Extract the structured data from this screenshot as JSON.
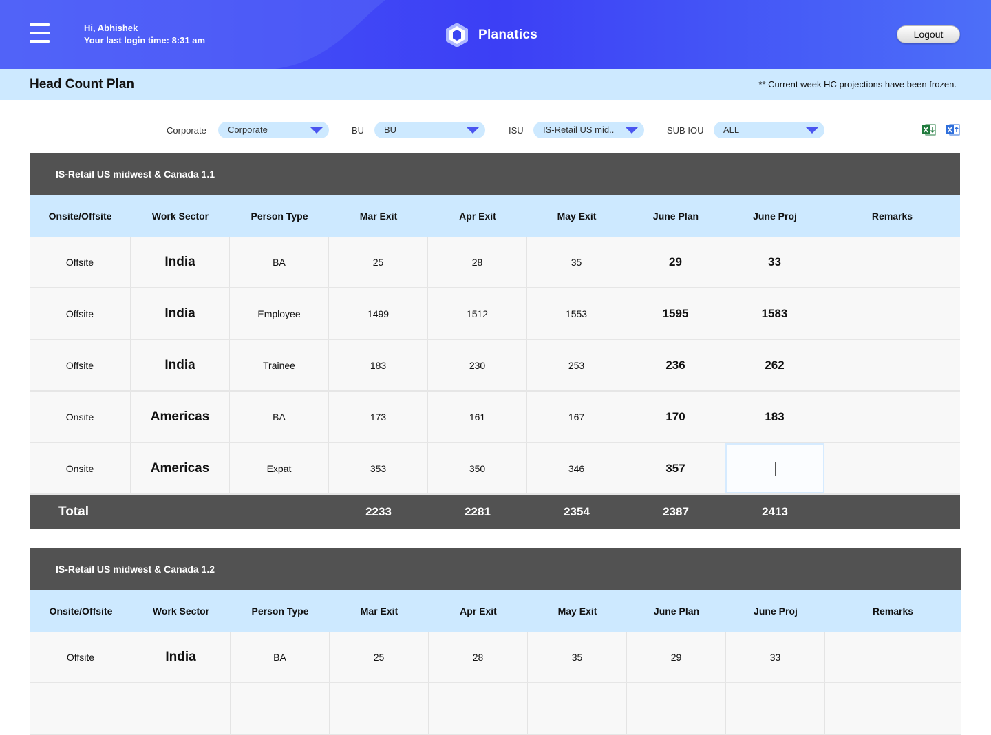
{
  "header": {
    "greeting": "Hi, Abhishek",
    "last_login": "Your last login time: 8:31 am",
    "brand_name": "Planatics",
    "logout_label": "Logout"
  },
  "titlebar": {
    "title": "Head Count Plan",
    "note": "** Current week HC projections have been frozen."
  },
  "filters": {
    "corporate": {
      "label": "Corporate",
      "value": "Corporate"
    },
    "bu": {
      "label": "BU",
      "value": "BU"
    },
    "isu": {
      "label": "ISU",
      "value": "IS-Retail US mid.."
    },
    "subiou": {
      "label": "SUB IOU",
      "value": "ALL"
    }
  },
  "export_icons": [
    "excel-download-icon",
    "excel-upload-icon"
  ],
  "colors": {
    "header": "#3b4cf5",
    "accent_light": "#cde9ff",
    "section_bar": "#525252",
    "excel_green": "#1f7a3c",
    "upload_blue": "#2f6fdb"
  },
  "columns": [
    "Onsite/Offsite",
    "Work Sector",
    "Person Type",
    "Mar Exit",
    "Apr Exit",
    "May Exit",
    "June Plan",
    "June Proj",
    "Remarks"
  ],
  "sections": [
    {
      "title": "IS-Retail US midwest & Canada 1.1",
      "rows": [
        [
          "Offsite",
          "India",
          "BA",
          "25",
          "28",
          "35",
          "29",
          "33",
          ""
        ],
        [
          "Offsite",
          "India",
          "Employee",
          "1499",
          "1512",
          "1553",
          "1595",
          "1583",
          ""
        ],
        [
          "Offsite",
          "India",
          "Trainee",
          "183",
          "230",
          "253",
          "236",
          "262",
          ""
        ],
        [
          "Onsite",
          "Americas",
          "BA",
          "173",
          "161",
          "167",
          "170",
          "183",
          ""
        ],
        [
          "Onsite",
          "Americas",
          "Expat",
          "353",
          "350",
          "346",
          "357",
          "",
          ""
        ]
      ],
      "total": [
        "Total",
        "",
        "",
        "2233",
        "2281",
        "2354",
        "2387",
        "2413",
        ""
      ]
    },
    {
      "title": "IS-Retail US midwest & Canada 1.2",
      "rows": [
        [
          "Offsite",
          "India",
          "BA",
          "25",
          "28",
          "35",
          "29",
          "33",
          ""
        ],
        [
          "",
          "",
          "",
          "",
          "",
          "",
          "",
          "",
          ""
        ]
      ]
    }
  ]
}
